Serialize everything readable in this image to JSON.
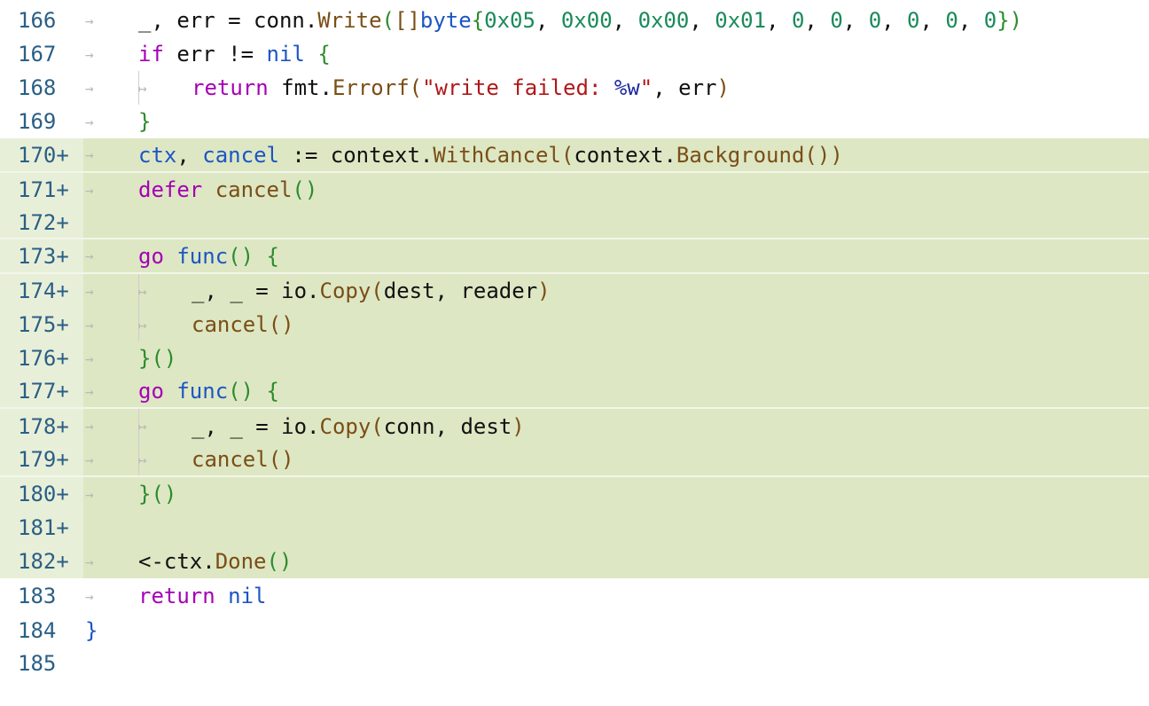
{
  "lines": [
    {
      "number": "166",
      "marker": "",
      "added": false,
      "tokens": [
        [
          "plain",
          "_, err = conn."
        ],
        [
          "fn",
          "Write"
        ],
        [
          "brace1",
          "("
        ],
        [
          "brace2",
          "[]"
        ],
        [
          "type",
          "byte"
        ],
        [
          "brace1",
          "{"
        ],
        [
          "num",
          "0x05"
        ],
        [
          "plain",
          ", "
        ],
        [
          "num",
          "0x00"
        ],
        [
          "plain",
          ", "
        ],
        [
          "num",
          "0x00"
        ],
        [
          "plain",
          ", "
        ],
        [
          "num",
          "0x01"
        ],
        [
          "plain",
          ", "
        ],
        [
          "num",
          "0"
        ],
        [
          "plain",
          ", "
        ],
        [
          "num",
          "0"
        ],
        [
          "plain",
          ", "
        ],
        [
          "num",
          "0"
        ],
        [
          "plain",
          ", "
        ],
        [
          "num",
          "0"
        ],
        [
          "plain",
          ", "
        ],
        [
          "num",
          "0"
        ],
        [
          "plain",
          ", "
        ],
        [
          "num",
          "0"
        ],
        [
          "brace1",
          "}"
        ],
        [
          "brace1",
          ")"
        ]
      ]
    },
    {
      "number": "167",
      "marker": "",
      "added": false,
      "tokens": [
        [
          "kw",
          "if"
        ],
        [
          "plain",
          " err != "
        ],
        [
          "type",
          "nil"
        ],
        [
          "plain",
          " "
        ],
        [
          "brace1",
          "{"
        ]
      ]
    },
    {
      "number": "168",
      "marker": "",
      "added": false,
      "nested": true,
      "tokens": [
        [
          "kw",
          "return"
        ],
        [
          "plain",
          " fmt."
        ],
        [
          "fn",
          "Errorf"
        ],
        [
          "brace2",
          "("
        ],
        [
          "str",
          "\"write failed: "
        ],
        [
          "fmt",
          "%w"
        ],
        [
          "str",
          "\""
        ],
        [
          "plain",
          ", err"
        ],
        [
          "brace2",
          ")"
        ]
      ]
    },
    {
      "number": "169",
      "marker": "",
      "added": false,
      "tokens": [
        [
          "brace1",
          "}"
        ]
      ]
    },
    {
      "number": "170",
      "marker": "+",
      "added": true,
      "sep": true,
      "tokens": [
        [
          "type",
          "ctx"
        ],
        [
          "plain",
          ", "
        ],
        [
          "type",
          "cancel"
        ],
        [
          "plain",
          " := context."
        ],
        [
          "fn",
          "WithCancel"
        ],
        [
          "brace2",
          "("
        ],
        [
          "plain",
          "context."
        ],
        [
          "fn",
          "Background"
        ],
        [
          "brace2",
          "()"
        ],
        [
          "brace2",
          ")"
        ]
      ]
    },
    {
      "number": "171",
      "marker": "+",
      "added": true,
      "tokens": [
        [
          "kw",
          "defer"
        ],
        [
          "plain",
          " "
        ],
        [
          "fn",
          "cancel"
        ],
        [
          "brace1",
          "()"
        ]
      ]
    },
    {
      "number": "172",
      "marker": "+",
      "added": true,
      "sep": true,
      "empty": true,
      "tokens": []
    },
    {
      "number": "173",
      "marker": "+",
      "added": true,
      "sep": true,
      "tokens": [
        [
          "kw",
          "go"
        ],
        [
          "plain",
          " "
        ],
        [
          "type",
          "func"
        ],
        [
          "brace1",
          "()"
        ],
        [
          "plain",
          " "
        ],
        [
          "brace1",
          "{"
        ]
      ]
    },
    {
      "number": "174",
      "marker": "+",
      "added": true,
      "nested": true,
      "tokens": [
        [
          "plain",
          "_, _ = io."
        ],
        [
          "fn",
          "Copy"
        ],
        [
          "brace2",
          "("
        ],
        [
          "plain",
          "dest, reader"
        ],
        [
          "brace2",
          ")"
        ]
      ]
    },
    {
      "number": "175",
      "marker": "+",
      "added": true,
      "nested": true,
      "tokens": [
        [
          "fn",
          "cancel"
        ],
        [
          "brace2",
          "()"
        ]
      ]
    },
    {
      "number": "176",
      "marker": "+",
      "added": true,
      "tokens": [
        [
          "brace1",
          "}"
        ],
        [
          "brace1",
          "()"
        ]
      ]
    },
    {
      "number": "177",
      "marker": "+",
      "added": true,
      "sep": true,
      "tokens": [
        [
          "kw",
          "go"
        ],
        [
          "plain",
          " "
        ],
        [
          "type",
          "func"
        ],
        [
          "brace1",
          "()"
        ],
        [
          "plain",
          " "
        ],
        [
          "brace1",
          "{"
        ]
      ]
    },
    {
      "number": "178",
      "marker": "+",
      "added": true,
      "nested": true,
      "tokens": [
        [
          "plain",
          "_, _ = io."
        ],
        [
          "fn",
          "Copy"
        ],
        [
          "brace2",
          "("
        ],
        [
          "plain",
          "conn, dest"
        ],
        [
          "brace2",
          ")"
        ]
      ]
    },
    {
      "number": "179",
      "marker": "+",
      "added": true,
      "nested": true,
      "sep": true,
      "tokens": [
        [
          "fn",
          "cancel"
        ],
        [
          "brace2",
          "()"
        ]
      ]
    },
    {
      "number": "180",
      "marker": "+",
      "added": true,
      "tokens": [
        [
          "brace1",
          "}"
        ],
        [
          "brace1",
          "()"
        ]
      ]
    },
    {
      "number": "181",
      "marker": "+",
      "added": true,
      "empty": true,
      "tokens": []
    },
    {
      "number": "182",
      "marker": "+",
      "added": true,
      "tokens": [
        [
          "plain",
          "<-ctx."
        ],
        [
          "fn",
          "Done"
        ],
        [
          "brace1",
          "()"
        ]
      ]
    },
    {
      "number": "183",
      "marker": "",
      "added": false,
      "tokens": [
        [
          "kw",
          "return"
        ],
        [
          "plain",
          " "
        ],
        [
          "type",
          "nil"
        ]
      ]
    },
    {
      "number": "184",
      "marker": "",
      "added": false,
      "noindent": true,
      "tokens": [
        [
          "brace3",
          "}"
        ]
      ]
    },
    {
      "number": "185",
      "marker": "",
      "added": false,
      "empty": true,
      "noindent": true,
      "tokens": []
    }
  ],
  "tab_glyph": "→",
  "nested_glyph": "↦"
}
